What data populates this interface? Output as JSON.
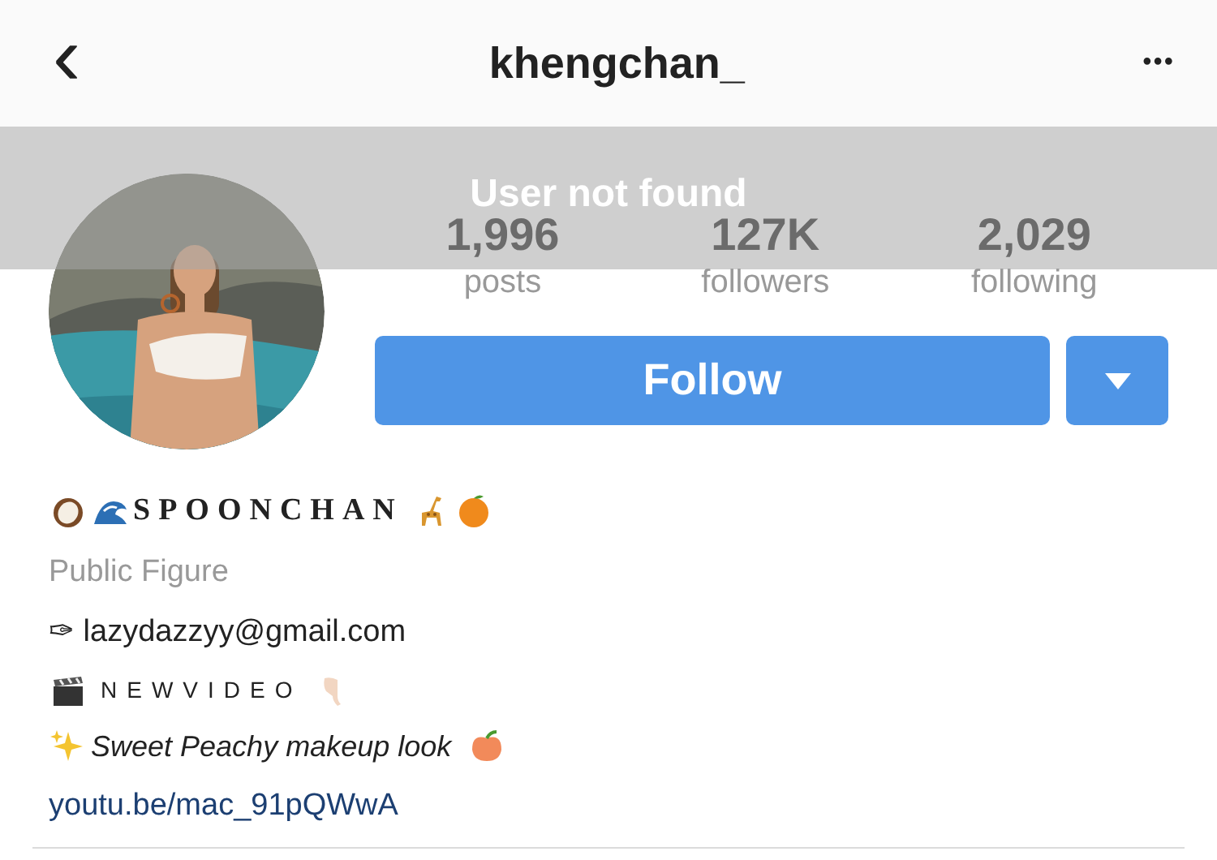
{
  "header": {
    "back": "‹",
    "title": "khengchan_",
    "more": "•••"
  },
  "toast": {
    "message": "User not found"
  },
  "stats": [
    {
      "value": "1,996",
      "label": "posts"
    },
    {
      "value": "127K",
      "label": "followers"
    },
    {
      "value": "2,029",
      "label": "following"
    }
  ],
  "follow_button": "Follow",
  "bio": [
    {
      "kind": "name",
      "text": "SPOONCHAN"
    },
    {
      "kind": "category",
      "text": "Public Figure"
    },
    {
      "kind": "text",
      "text": "✑ lazydazzyy@gmail.com"
    },
    {
      "kind": "spaced",
      "text": "NEWVIDEO"
    },
    {
      "kind": "italic",
      "text": "Sweet Peachy makeup look"
    },
    {
      "kind": "link",
      "text": "youtu.be/mac_91pQWwA"
    }
  ]
}
